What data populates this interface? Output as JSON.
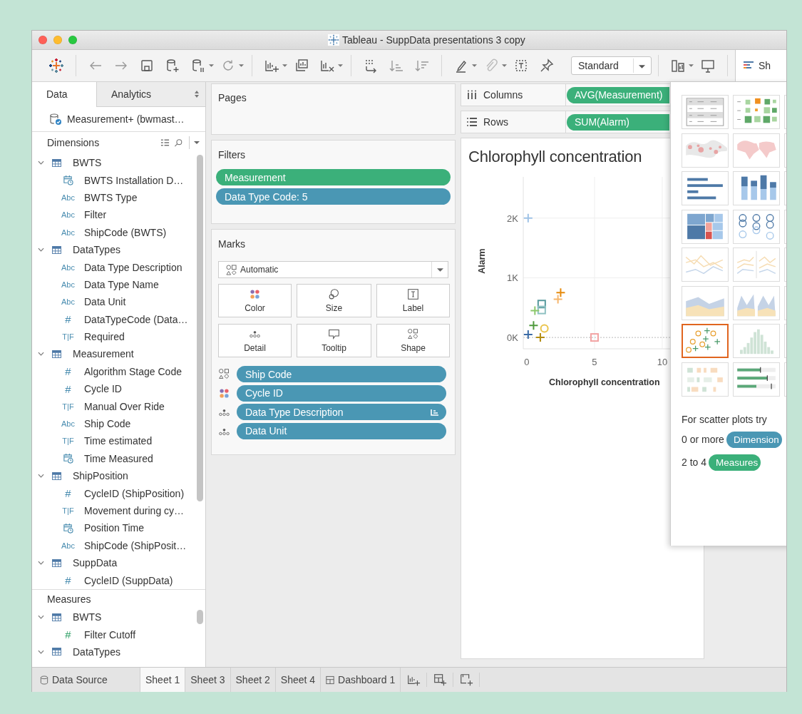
{
  "window": {
    "title": "Tableau - SuppData presentations 3 copy"
  },
  "toolbar": {
    "presentation_mode": "Standard",
    "show_me_tab": "Sh"
  },
  "data_pane": {
    "tabs": [
      {
        "label": "Data",
        "selected": true
      },
      {
        "label": "Analytics",
        "selected": false
      }
    ],
    "data_source": "Measurement+ (bwmast…",
    "dimensions": {
      "title": "Dimensions",
      "tables": [
        {
          "name": "BWTS",
          "expanded": true,
          "children": [
            {
              "name": "BWTS Installation D…",
              "kind": "date"
            },
            {
              "name": "BWTS Type",
              "kind": "text",
              "glyph": "Abc"
            },
            {
              "name": "Filter",
              "kind": "text",
              "glyph": "Abc"
            },
            {
              "name": "ShipCode (BWTS)",
              "kind": "text",
              "glyph": "Abc"
            }
          ]
        },
        {
          "name": "DataTypes",
          "expanded": true,
          "children": [
            {
              "name": "Data Type Description",
              "kind": "text",
              "glyph": "Abc"
            },
            {
              "name": "Data Type Name",
              "kind": "text",
              "glyph": "Abc"
            },
            {
              "name": "Data Unit",
              "kind": "text",
              "glyph": "Abc"
            },
            {
              "name": "DataTypeCode (Data…",
              "kind": "number",
              "glyph": "#"
            },
            {
              "name": "Required",
              "kind": "boolean",
              "glyph": "T|F"
            }
          ]
        },
        {
          "name": "Measurement",
          "expanded": true,
          "children": [
            {
              "name": "Algorithm Stage Code",
              "kind": "number",
              "glyph": "#"
            },
            {
              "name": "Cycle ID",
              "kind": "number",
              "glyph": "#"
            },
            {
              "name": "Manual Over Ride",
              "kind": "boolean",
              "glyph": "T|F"
            },
            {
              "name": "Ship Code",
              "kind": "text",
              "glyph": "Abc"
            },
            {
              "name": "Time estimated",
              "kind": "boolean",
              "glyph": "T|F"
            },
            {
              "name": "Time Measured",
              "kind": "date"
            }
          ]
        },
        {
          "name": "ShipPosition",
          "expanded": true,
          "children": [
            {
              "name": "CycleID (ShipPosition)",
              "kind": "number",
              "glyph": "#"
            },
            {
              "name": "Movement during cy…",
              "kind": "boolean",
              "glyph": "T|F"
            },
            {
              "name": "Position Time",
              "kind": "date"
            },
            {
              "name": "ShipCode (ShipPosit…",
              "kind": "text",
              "glyph": "Abc"
            }
          ]
        },
        {
          "name": "SuppData",
          "expanded": true,
          "children": [
            {
              "name": "CycleID (SuppData)",
              "kind": "number",
              "glyph": "#"
            }
          ]
        }
      ]
    },
    "measures": {
      "title": "Measures",
      "tables": [
        {
          "name": "BWTS",
          "expanded": true,
          "children": [
            {
              "name": "Filter Cutoff",
              "kind": "number",
              "glyph": "#"
            }
          ]
        },
        {
          "name": "DataTypes",
          "expanded": true
        }
      ]
    }
  },
  "pages_shelf": {
    "title": "Pages"
  },
  "filters_shelf": {
    "title": "Filters",
    "pills": [
      {
        "label": "Measurement",
        "kind": "measure"
      },
      {
        "label": "Data Type Code: 5",
        "kind": "dimension"
      }
    ]
  },
  "marks": {
    "title": "Marks",
    "mark_type": "Automatic",
    "cards": [
      {
        "label": "Color",
        "kind": "color"
      },
      {
        "label": "Size",
        "kind": "size"
      },
      {
        "label": "Label",
        "kind": "label"
      },
      {
        "label": "Detail",
        "kind": "detail"
      },
      {
        "label": "Tooltip",
        "kind": "tooltip"
      },
      {
        "label": "Shape",
        "kind": "shape"
      }
    ],
    "pills": [
      {
        "label": "Ship Code",
        "kind": "shape",
        "discrete": true,
        "sorted": false
      },
      {
        "label": "Cycle ID",
        "kind": "color",
        "discrete": true,
        "sorted": false
      },
      {
        "label": "Data Type Description",
        "kind": "detail",
        "discrete": true,
        "sorted": true
      },
      {
        "label": "Data Unit",
        "kind": "detail",
        "discrete": true,
        "sorted": false
      }
    ]
  },
  "columns_shelf": {
    "label": "Columns",
    "pills": [
      {
        "label": "AVG(Measurement)",
        "kind": "measure"
      }
    ]
  },
  "rows_shelf": {
    "label": "Rows",
    "pills": [
      {
        "label": "SUM(Alarm)",
        "kind": "measure"
      }
    ]
  },
  "sheet": {
    "title": "Chlorophyll concentration",
    "chart_data": {
      "type": "scatter",
      "xlabel": "Chlorophyll concentration",
      "ylabel": "Alarm",
      "grid": true,
      "ref_lines": [
        {
          "axis": "y",
          "value": 0
        }
      ],
      "xlim": [
        -0.26,
        10.58
      ],
      "ylim": [
        -190,
        2690
      ],
      "xticks": [
        0,
        5,
        10
      ],
      "yticks": [
        {
          "value": 0,
          "label": "0K"
        },
        {
          "value": 1000,
          "label": "1K"
        },
        {
          "value": 2000,
          "label": "2K"
        }
      ],
      "series": [
        {
          "color": "#9fc3e6",
          "marker": "plus",
          "x": [
            0.1
          ],
          "values": [
            2000
          ]
        },
        {
          "color": "#e68a0c",
          "marker": "plus",
          "x": [
            2.5
          ],
          "values": [
            750
          ]
        },
        {
          "color": "#f6b66c",
          "marker": "plus",
          "x": [
            2.3
          ],
          "values": [
            640
          ]
        },
        {
          "color": "#579a9d",
          "marker": "square",
          "x": [
            1.1
          ],
          "values": [
            560
          ]
        },
        {
          "color": "#8fc1c2",
          "marker": "square",
          "x": [
            1.1
          ],
          "values": [
            460
          ]
        },
        {
          "color": "#8cc86c",
          "marker": "plus",
          "x": [
            0.6
          ],
          "values": [
            450
          ]
        },
        {
          "color": "#4f9a3c",
          "marker": "plus",
          "x": [
            0.5
          ],
          "values": [
            200
          ]
        },
        {
          "color": "#eac44c",
          "marker": "circle",
          "x": [
            1.3
          ],
          "values": [
            150
          ]
        },
        {
          "color": "#3b6ba6",
          "marker": "plus",
          "x": [
            0.1
          ],
          "values": [
            50
          ]
        },
        {
          "color": "#b28c12",
          "marker": "plus",
          "x": [
            1.0
          ],
          "values": [
            0
          ]
        },
        {
          "color": "#f2a3a3",
          "marker": "square",
          "x": [
            5
          ],
          "values": [
            0
          ]
        }
      ]
    }
  },
  "show_me": {
    "charts": [
      {
        "kind": "text-table",
        "selected": false
      },
      {
        "kind": "heat-map",
        "selected": false
      },
      {
        "kind": "symbol-map",
        "selected": false
      },
      {
        "kind": "filled-map",
        "selected": false
      },
      {
        "kind": "horizontal-bars",
        "selected": false
      },
      {
        "kind": "stacked-bars",
        "selected": false
      },
      {
        "kind": "treemap",
        "selected": false
      },
      {
        "kind": "circle-views",
        "selected": false
      },
      {
        "kind": "lines-continuous",
        "selected": false
      },
      {
        "kind": "lines-discrete",
        "selected": false
      },
      {
        "kind": "area-continuous",
        "selected": false
      },
      {
        "kind": "area-discrete",
        "selected": false
      },
      {
        "kind": "scatter",
        "selected": true
      },
      {
        "kind": "histogram",
        "selected": false
      },
      {
        "kind": "gantt",
        "selected": false
      },
      {
        "kind": "bullet",
        "selected": false
      }
    ],
    "hint": "For scatter plots try",
    "requirements": [
      {
        "text": "0 or more",
        "pill": "Dimension",
        "kind": "dimension"
      },
      {
        "text": "2 to 4",
        "pill": "Measures",
        "kind": "measure"
      }
    ]
  },
  "sheet_tabs": [
    {
      "label": "Data Source",
      "kind": "datasource",
      "selected": false
    },
    {
      "label": "Sheet 1",
      "kind": "sheet",
      "selected": true
    },
    {
      "label": "Sheet 3",
      "kind": "sheet",
      "selected": false
    },
    {
      "label": "Sheet 2",
      "kind": "sheet",
      "selected": false
    },
    {
      "label": "Sheet 4",
      "kind": "sheet",
      "selected": false
    },
    {
      "label": "Dashboard 1",
      "kind": "dashboard",
      "selected": false
    }
  ]
}
